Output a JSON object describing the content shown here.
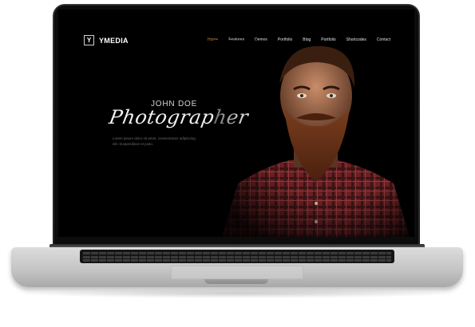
{
  "site": {
    "logo_letter": "Y",
    "logo_text": "YMEDIA"
  },
  "nav": {
    "items": [
      {
        "label": "Home",
        "active": true
      },
      {
        "label": "Features",
        "active": false
      },
      {
        "label": "Demos",
        "active": false
      },
      {
        "label": "Portfolio",
        "active": false
      },
      {
        "label": "Blog",
        "active": false
      },
      {
        "label": "Portfolio",
        "active": false
      },
      {
        "label": "Shortcodes",
        "active": false
      },
      {
        "label": "Contact",
        "active": false
      }
    ],
    "active_color": "#d9822b"
  },
  "hero": {
    "name": "JOHN DOE",
    "title": "Photographer",
    "description": "Lorem ipsum dolor sit amet, consectetuer adipiscing elit. Suspendisse et justo."
  }
}
